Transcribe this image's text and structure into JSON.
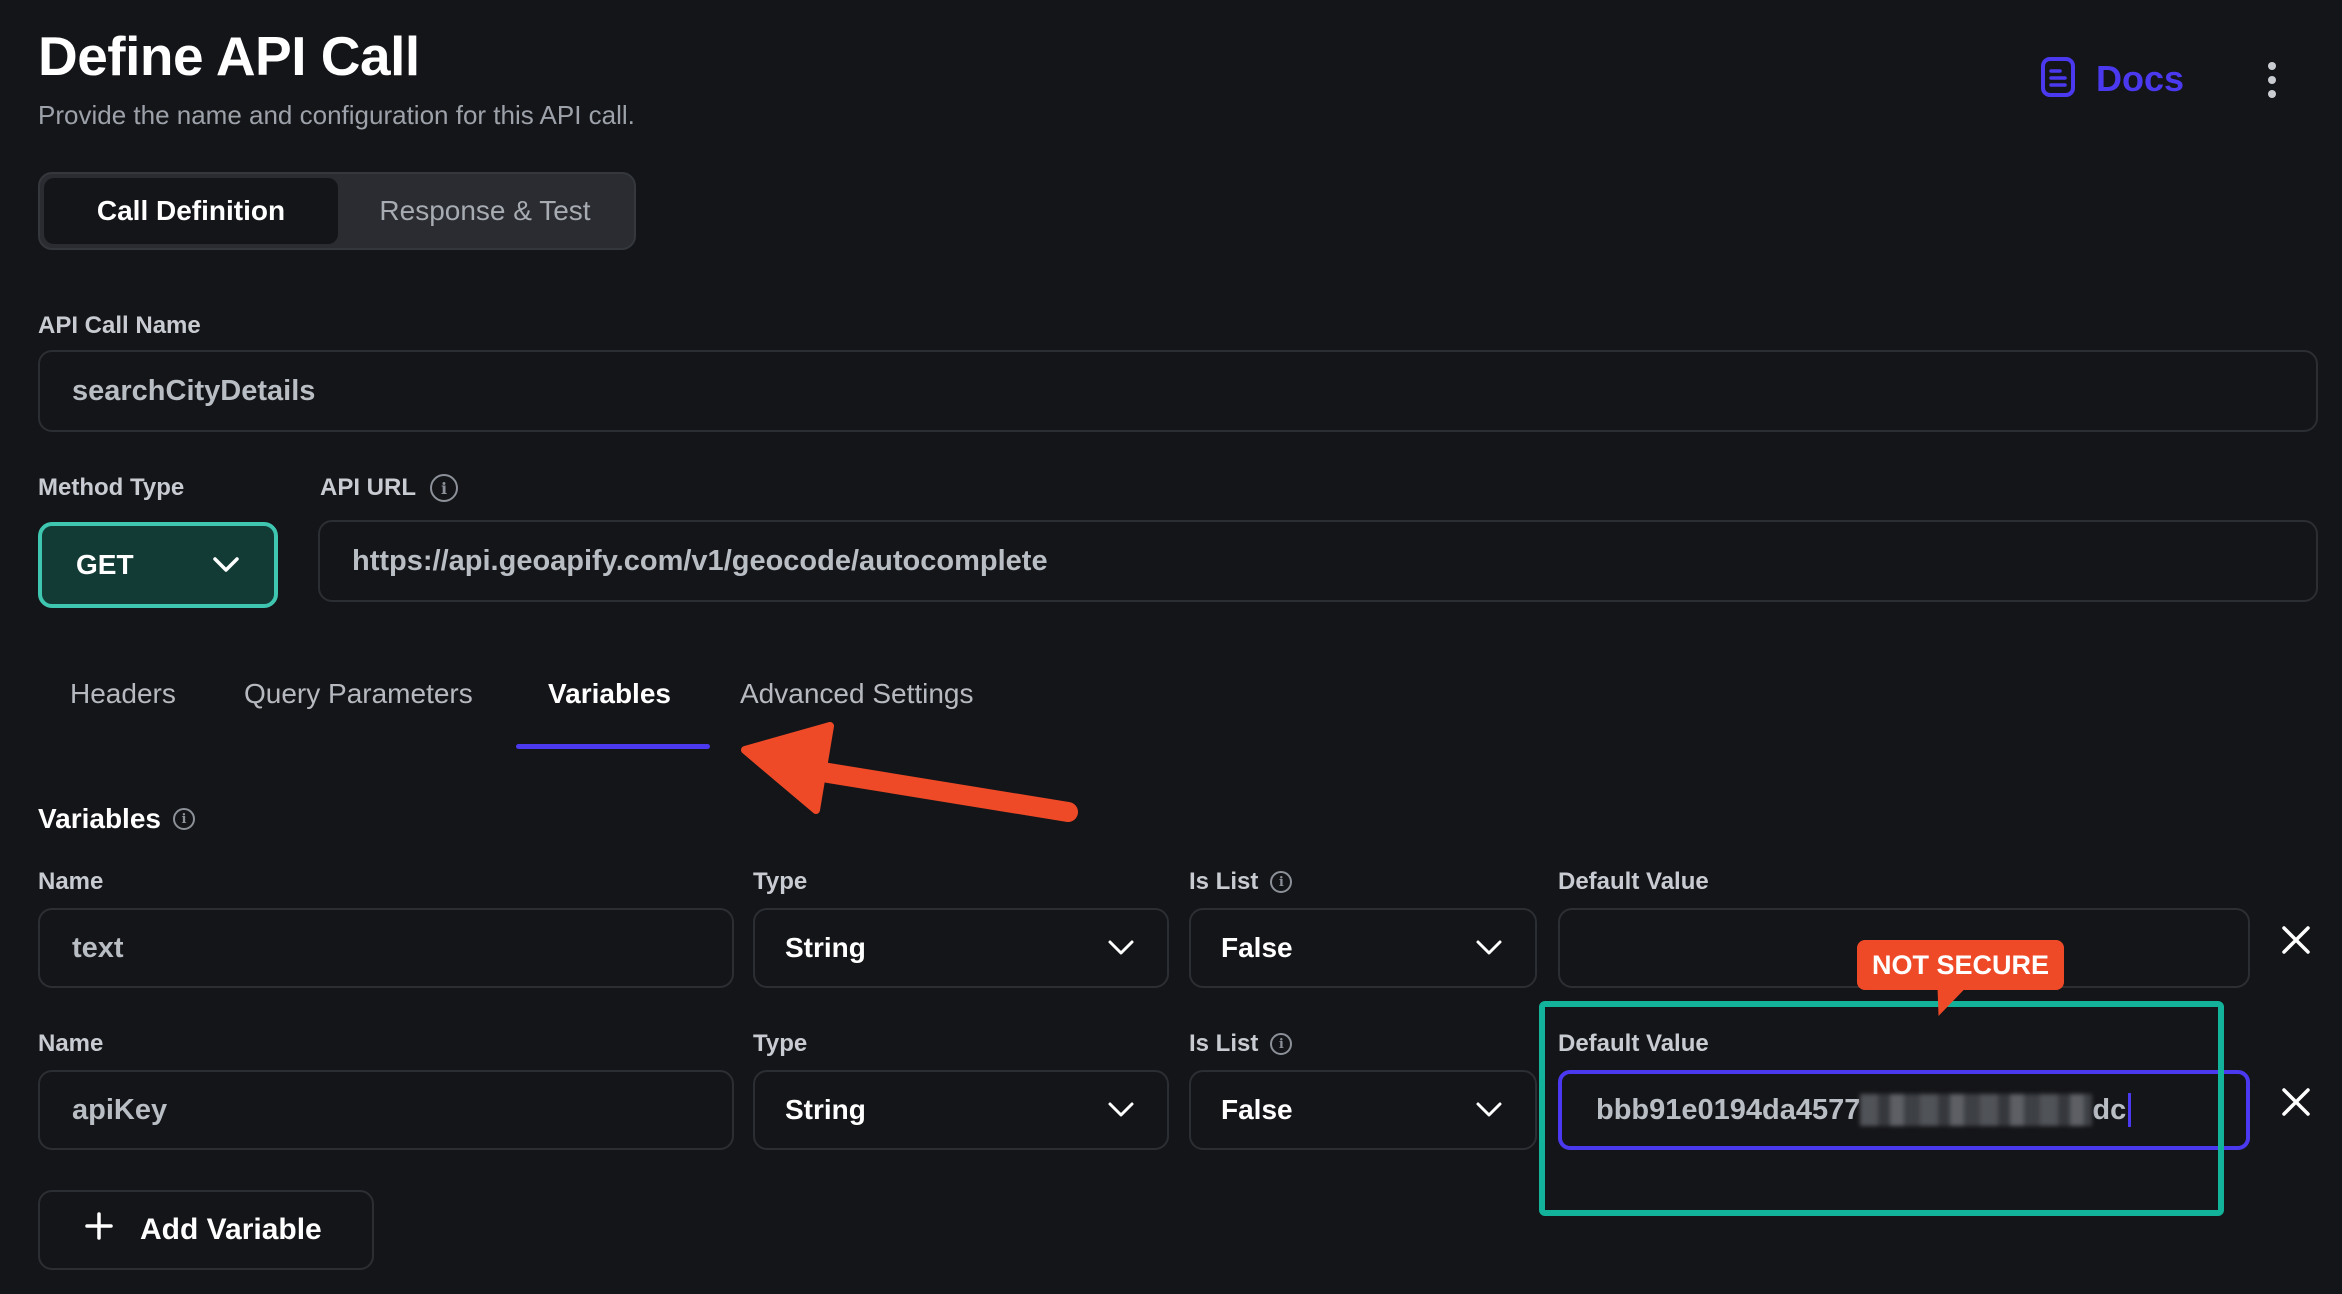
{
  "header": {
    "title": "Define API Call",
    "subtitle": "Provide the name and configuration for this API call.",
    "docs_label": "Docs",
    "docs_icon": "document-icon",
    "more_icon": "kebab-menu-icon"
  },
  "segments": {
    "call_definition": "Call Definition",
    "response_test": "Response & Test",
    "active": "Call Definition"
  },
  "form": {
    "api_call_name_label": "API Call Name",
    "api_call_name_value": "searchCityDetails",
    "method_type_label": "Method Type",
    "method_value": "GET",
    "api_url_label": "API URL",
    "api_url_value": "https://api.geoapify.com/v1/geocode/autocomplete"
  },
  "tabs": {
    "headers": "Headers",
    "query_parameters": "Query Parameters",
    "variables": "Variables",
    "advanced_settings": "Advanced Settings",
    "active": "Variables"
  },
  "variables": {
    "section_title": "Variables",
    "rows": [
      {
        "name_label": "Name",
        "name": "text",
        "type_label": "Type",
        "type": "String",
        "is_list_label": "Is List",
        "is_list": "False",
        "default_label": "Default Value",
        "default_value": ""
      },
      {
        "name_label": "Name",
        "name": "apiKey",
        "type_label": "Type",
        "type": "String",
        "is_list_label": "Is List",
        "is_list": "False",
        "default_label": "Default Value",
        "default_value_visible_start": "bbb91e0194da4577",
        "default_value_visible_end": "dc"
      }
    ],
    "add_label": "Add Variable"
  },
  "annotations": {
    "badge": "NOT SECURE",
    "badge_color": "#ef4a28",
    "highlight_color": "#12b39a",
    "arrow_color": "#ef4a28"
  },
  "colors": {
    "accent": "#4b39ef",
    "method_bg": "#123b36",
    "method_border": "#3fc6b0",
    "background": "#141518"
  }
}
